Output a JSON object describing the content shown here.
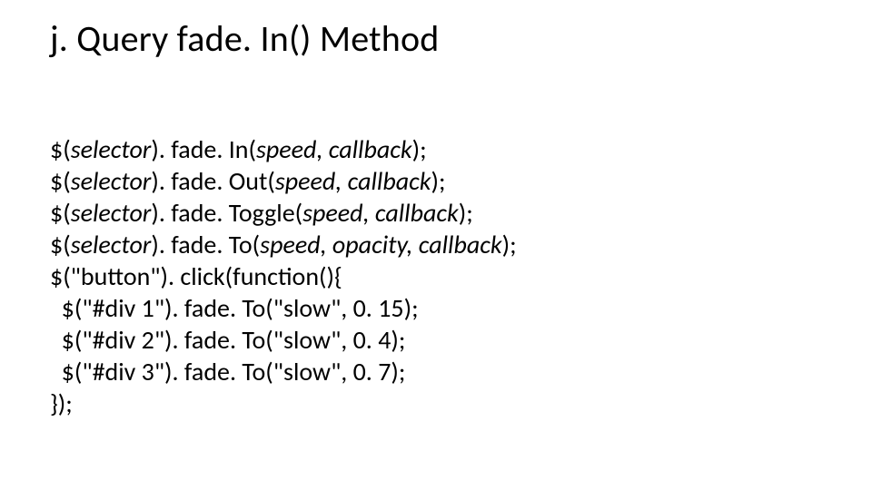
{
  "title": "j. Query fade. In() Method",
  "lines": [
    [
      {
        "t": "$(",
        "i": false
      },
      {
        "t": "selector",
        "i": true
      },
      {
        "t": "). fade. In(",
        "i": false
      },
      {
        "t": "speed, callback",
        "i": true
      },
      {
        "t": ");",
        "i": false
      }
    ],
    [
      {
        "t": "$(",
        "i": false
      },
      {
        "t": "selector",
        "i": true
      },
      {
        "t": "). fade. Out(",
        "i": false
      },
      {
        "t": "speed, callback",
        "i": true
      },
      {
        "t": ");",
        "i": false
      }
    ],
    [
      {
        "t": "$(",
        "i": false
      },
      {
        "t": "selector",
        "i": true
      },
      {
        "t": "). fade. Toggle(",
        "i": false
      },
      {
        "t": "speed, callback",
        "i": true
      },
      {
        "t": ");",
        "i": false
      }
    ],
    [
      {
        "t": "$(",
        "i": false
      },
      {
        "t": "selector",
        "i": true
      },
      {
        "t": "). fade. To(",
        "i": false
      },
      {
        "t": "speed, opacity, callback",
        "i": true
      },
      {
        "t": ");",
        "i": false
      }
    ],
    [
      {
        "t": "$(\"button\"). click(function(){",
        "i": false
      }
    ],
    [
      {
        "t": "  $(\"#div 1\"). fade. To(\"slow\", 0. 15);",
        "i": false
      }
    ],
    [
      {
        "t": "  $(\"#div 2\"). fade. To(\"slow\", 0. 4);",
        "i": false
      }
    ],
    [
      {
        "t": "  $(\"#div 3\"). fade. To(\"slow\", 0. 7);",
        "i": false
      }
    ],
    [
      {
        "t": "});",
        "i": false
      }
    ]
  ]
}
